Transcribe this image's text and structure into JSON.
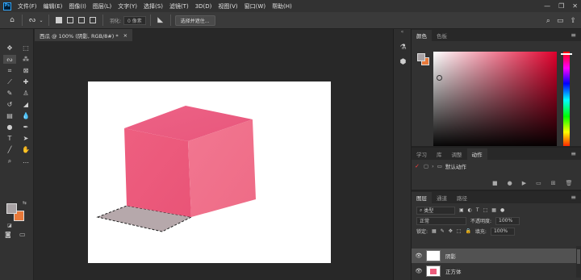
{
  "menubar": {
    "logo": "Ps",
    "items": [
      "文件(F)",
      "编辑(E)",
      "图像(I)",
      "图层(L)",
      "文字(Y)",
      "选择(S)",
      "滤镜(T)",
      "3D(D)",
      "视图(V)",
      "窗口(W)",
      "帮助(H)"
    ],
    "window_controls": {
      "minimize": "—",
      "restore": "❐",
      "close": "✕"
    }
  },
  "options": {
    "feather_label": "羽化:",
    "feather_value": "0 像素",
    "select_subject": "选择并遮住..."
  },
  "document": {
    "tab_title": "西瓜 @ 100% (阴影, RGB/8#) *",
    "close": "×"
  },
  "colors": {
    "foreground": "#a8a2a4",
    "background": "#e8793a",
    "cube_front": "#ec5c7c",
    "shadow": "#b6a8ab"
  },
  "color_panel": {
    "tabs": [
      "颜色",
      "色板"
    ]
  },
  "actions_panel": {
    "tabs": [
      "学习",
      "库",
      "调整",
      "动作"
    ],
    "row_label": "默认动作"
  },
  "layers_panel": {
    "tabs": [
      "图层",
      "通道",
      "路径"
    ],
    "filter_label": "类型",
    "blend_mode": "正常",
    "opacity_label": "不透明度:",
    "opacity_value": "100%",
    "lock_label": "锁定:",
    "fill_label": "填充:",
    "fill_value": "100%",
    "layers": [
      {
        "name": "阴影"
      },
      {
        "name": "正方体"
      }
    ]
  }
}
